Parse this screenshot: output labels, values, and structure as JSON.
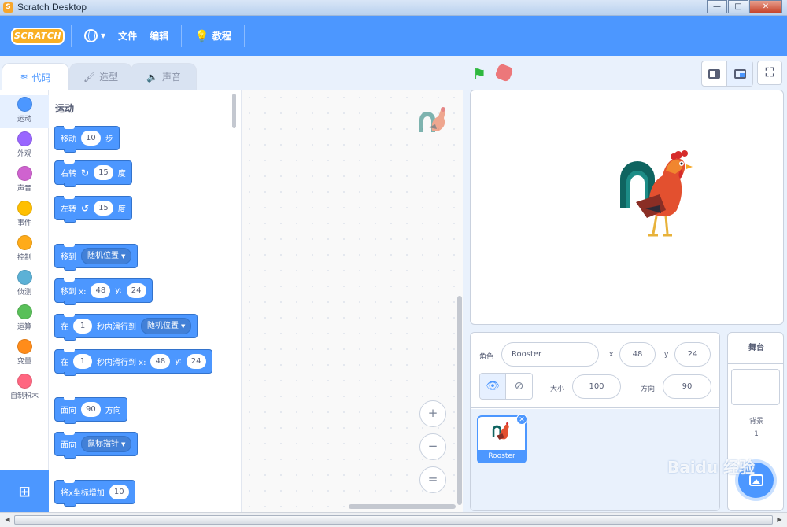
{
  "window": {
    "title": "Scratch Desktop",
    "minimize": "—",
    "maximize": "□",
    "close": "✕"
  },
  "menubar": {
    "logo": "SCRATCH",
    "file": "文件",
    "edit": "编辑",
    "tutorials": "教程"
  },
  "tabs": {
    "code": "代码",
    "costumes": "造型",
    "sounds": "声音"
  },
  "categories": [
    {
      "label": "运动",
      "color": "#4c97ff"
    },
    {
      "label": "外观",
      "color": "#9966ff"
    },
    {
      "label": "声音",
      "color": "#cf63cf"
    },
    {
      "label": "事件",
      "color": "#ffbf00"
    },
    {
      "label": "控制",
      "color": "#ffab19"
    },
    {
      "label": "侦测",
      "color": "#5cb1d6"
    },
    {
      "label": "运算",
      "color": "#59c059"
    },
    {
      "label": "变量",
      "color": "#ff8c1a"
    },
    {
      "label": "自制积木",
      "color": "#ff6680"
    }
  ],
  "palette": {
    "title": "运动",
    "move": {
      "a": "移动",
      "n": "10",
      "b": "步"
    },
    "turn_right": {
      "a": "右转",
      "n": "15",
      "b": "度"
    },
    "turn_left": {
      "a": "左转",
      "n": "15",
      "b": "度"
    },
    "goto": {
      "a": "移到",
      "d": "随机位置"
    },
    "goto_xy": {
      "a": "移到 x:",
      "x": "48",
      "b": "y:",
      "y": "24"
    },
    "glide": {
      "a": "在",
      "n": "1",
      "b": "秒内滑行到",
      "d": "随机位置"
    },
    "glide_xy": {
      "a": "在",
      "n": "1",
      "b": "秒内滑行到 x:",
      "x": "48",
      "c": "y:",
      "y": "24"
    },
    "point_dir": {
      "a": "面向",
      "n": "90",
      "b": "方向"
    },
    "point_towards": {
      "a": "面向",
      "d": "鼠标指针"
    },
    "change_x": {
      "a": "将x坐标增加",
      "n": "10"
    }
  },
  "zoom": {
    "in": "+",
    "out": "−",
    "reset": "="
  },
  "sprite_info": {
    "sprite_label": "角色",
    "sprite_name": "Rooster",
    "x_label": "x",
    "x_value": "48",
    "y_label": "y",
    "y_value": "24",
    "show_label": "显示",
    "size_label": "大小",
    "size_value": "100",
    "direction_label": "方向",
    "direction_value": "90"
  },
  "sprites": [
    {
      "name": "Rooster"
    }
  ],
  "stage_pane": {
    "title": "舞台",
    "backdrops_label": "背景",
    "backdrops_count": "1"
  },
  "watermark": "Baidu 经验"
}
